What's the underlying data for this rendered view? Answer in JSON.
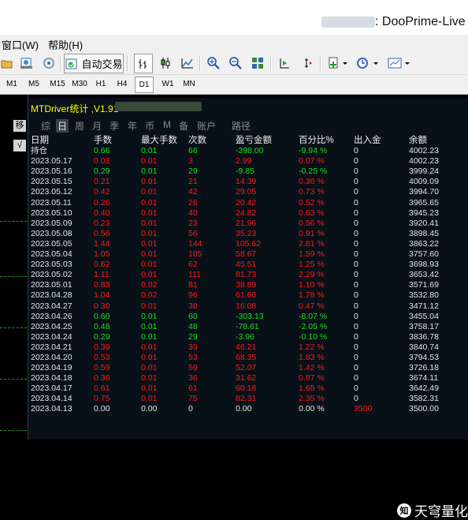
{
  "window": {
    "title": ": DooPrime-Live"
  },
  "menu": {
    "window": "窗口(W)",
    "help": "帮助(H)"
  },
  "toolbar": {
    "autotrade_label": "自动交易"
  },
  "timeframes": [
    "M1",
    "M5",
    "M15",
    "M30",
    "H1",
    "H4",
    "D1",
    "W1",
    "MN"
  ],
  "active_timeframe": "D1",
  "left_panel": {
    "button_label": "移"
  },
  "panel": {
    "title": "MTDriver统计 ,V1.91 "
  },
  "tabs": [
    {
      "label": "综",
      "active": false
    },
    {
      "label": "日",
      "active": true
    },
    {
      "label": "周",
      "active": false
    },
    {
      "label": "月",
      "active": false
    },
    {
      "label": "季",
      "active": false
    },
    {
      "label": "年",
      "active": false
    },
    {
      "label": "币",
      "active": false
    },
    {
      "label": "M",
      "active": false
    },
    {
      "label": "备",
      "active": false
    },
    {
      "label": "账户",
      "active": false
    },
    {
      "label": "路径",
      "active": false
    }
  ],
  "table": {
    "columns": [
      "日期",
      "手数",
      "最大手数",
      "次数",
      "盈亏金额",
      "百分比%",
      "出入金",
      "余额"
    ],
    "rows": [
      {
        "date": "持仓",
        "lots": "0.66",
        "max_lots": "0.01",
        "count": "66",
        "pnl": "-398.00",
        "pct": "-9.94 %",
        "flow": "0",
        "balance": "4002.23",
        "color": "g"
      },
      {
        "date": "2023.05.17",
        "lots": "0.03",
        "max_lots": "0.01",
        "count": "3",
        "pnl": "2.99",
        "pct": "0.07 %",
        "flow": "0",
        "balance": "4002.23",
        "color": "r"
      },
      {
        "date": "2023.05.16",
        "lots": "0.29",
        "max_lots": "0.01",
        "count": "29",
        "pnl": "-9.85",
        "pct": "-0.25 %",
        "flow": "0",
        "balance": "3999.24",
        "color": "g"
      },
      {
        "date": "2023.05.15",
        "lots": "0.21",
        "max_lots": "0.01",
        "count": "21",
        "pnl": "14.39",
        "pct": "0.36 %",
        "flow": "0",
        "balance": "4009.09",
        "color": "r"
      },
      {
        "date": "2023.05.12",
        "lots": "0.42",
        "max_lots": "0.01",
        "count": "42",
        "pnl": "29.05",
        "pct": "0.73 %",
        "flow": "0",
        "balance": "3994.70",
        "color": "r"
      },
      {
        "date": "2023.05.11",
        "lots": "0.26",
        "max_lots": "0.01",
        "count": "26",
        "pnl": "20.42",
        "pct": "0.52 %",
        "flow": "0",
        "balance": "3965.65",
        "color": "r"
      },
      {
        "date": "2023.05.10",
        "lots": "0.40",
        "max_lots": "0.01",
        "count": "40",
        "pnl": "24.82",
        "pct": "0.63 %",
        "flow": "0",
        "balance": "3945.23",
        "color": "r"
      },
      {
        "date": "2023.05.09",
        "lots": "0.23",
        "max_lots": "0.01",
        "count": "23",
        "pnl": "21.96",
        "pct": "0.56 %",
        "flow": "0",
        "balance": "3920.41",
        "color": "r"
      },
      {
        "date": "2023.05.08",
        "lots": "0.56",
        "max_lots": "0.01",
        "count": "56",
        "pnl": "35.23",
        "pct": "0.91 %",
        "flow": "0",
        "balance": "3898.45",
        "color": "r"
      },
      {
        "date": "2023.05.05",
        "lots": "1.44",
        "max_lots": "0.01",
        "count": "144",
        "pnl": "105.62",
        "pct": "2.81 %",
        "flow": "0",
        "balance": "3863.22",
        "color": "r"
      },
      {
        "date": "2023.05.04",
        "lots": "1.05",
        "max_lots": "0.01",
        "count": "105",
        "pnl": "58.67",
        "pct": "1.59 %",
        "flow": "0",
        "balance": "3757.60",
        "color": "r"
      },
      {
        "date": "2023.05.03",
        "lots": "0.62",
        "max_lots": "0.01",
        "count": "62",
        "pnl": "45.51",
        "pct": "1.25 %",
        "flow": "0",
        "balance": "3698.93",
        "color": "r"
      },
      {
        "date": "2023.05.02",
        "lots": "1.11",
        "max_lots": "0.01",
        "count": "111",
        "pnl": "81.73",
        "pct": "2.29 %",
        "flow": "0",
        "balance": "3653.42",
        "color": "r"
      },
      {
        "date": "2023.05.01",
        "lots": "0.83",
        "max_lots": "0.02",
        "count": "81",
        "pnl": "38.89",
        "pct": "1.10 %",
        "flow": "0",
        "balance": "3571.69",
        "color": "r"
      },
      {
        "date": "2023.04.28",
        "lots": "1.04",
        "max_lots": "0.02",
        "count": "96",
        "pnl": "61.68",
        "pct": "1.78 %",
        "flow": "0",
        "balance": "3532.80",
        "color": "r"
      },
      {
        "date": "2023.04.27",
        "lots": "0.30",
        "max_lots": "0.01",
        "count": "30",
        "pnl": "16.08",
        "pct": "0.47 %",
        "flow": "0",
        "balance": "3471.12",
        "color": "r"
      },
      {
        "date": "2023.04.26",
        "lots": "0.60",
        "max_lots": "0.01",
        "count": "60",
        "pnl": "-303.13",
        "pct": "-8.07 %",
        "flow": "0",
        "balance": "3455.04",
        "color": "g"
      },
      {
        "date": "2023.04.25",
        "lots": "0.48",
        "max_lots": "0.01",
        "count": "48",
        "pnl": "-78.61",
        "pct": "-2.05 %",
        "flow": "0",
        "balance": "3758.17",
        "color": "g"
      },
      {
        "date": "2023.04.24",
        "lots": "0.29",
        "max_lots": "0.01",
        "count": "29",
        "pnl": "-3.96",
        "pct": "-0.10 %",
        "flow": "0",
        "balance": "3836.78",
        "color": "g"
      },
      {
        "date": "2023.04.21",
        "lots": "0.39",
        "max_lots": "0.01",
        "count": "39",
        "pnl": "46.21",
        "pct": "1.22 %",
        "flow": "0",
        "balance": "3840.74",
        "color": "r"
      },
      {
        "date": "2023.04.20",
        "lots": "0.53",
        "max_lots": "0.01",
        "count": "53",
        "pnl": "68.35",
        "pct": "1.83 %",
        "flow": "0",
        "balance": "3794.53",
        "color": "r"
      },
      {
        "date": "2023.04.19",
        "lots": "0.59",
        "max_lots": "0.01",
        "count": "59",
        "pnl": "52.07",
        "pct": "1.42 %",
        "flow": "0",
        "balance": "3726.18",
        "color": "r"
      },
      {
        "date": "2023.04.18",
        "lots": "0.36",
        "max_lots": "0.01",
        "count": "36",
        "pnl": "31.62",
        "pct": "0.87 %",
        "flow": "0",
        "balance": "3674.11",
        "color": "r"
      },
      {
        "date": "2023.04.17",
        "lots": "0.61",
        "max_lots": "0.01",
        "count": "61",
        "pnl": "60.18",
        "pct": "1.68 %",
        "flow": "0",
        "balance": "3642.49",
        "color": "r"
      },
      {
        "date": "2023.04.14",
        "lots": "0.75",
        "max_lots": "0.01",
        "count": "75",
        "pnl": "82.31",
        "pct": "2.35 %",
        "flow": "0",
        "balance": "3582.31",
        "color": "r"
      },
      {
        "date": "2023.04.13",
        "lots": "0.00",
        "max_lots": "0.00",
        "count": "0",
        "pnl": "0.00",
        "pct": "0.00 %",
        "flow": "3500",
        "balance": "3500.00",
        "color": "w"
      }
    ]
  },
  "watermark": {
    "text": "天穹量化",
    "logo": "知"
  }
}
